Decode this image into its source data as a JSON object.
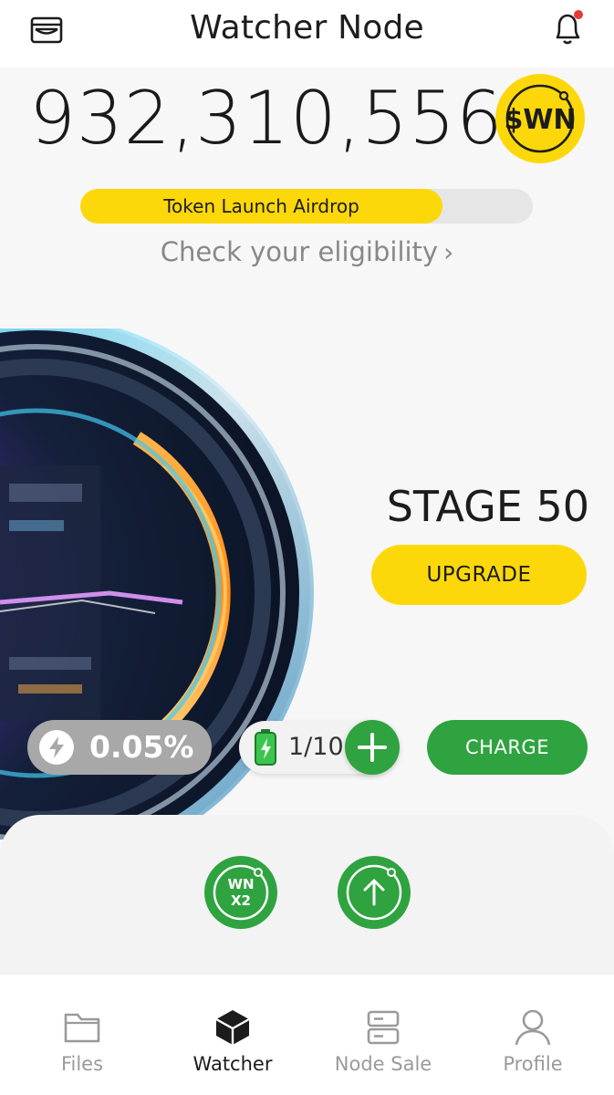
{
  "header": {
    "title": "Watcher Node",
    "wallet_icon": "wallet-icon",
    "bell_icon": "bell-icon",
    "notification_dot_color": "#e53935"
  },
  "balance": {
    "amount": "932,310,556",
    "token_symbol": "$WN"
  },
  "airdrop": {
    "label": "Token Launch Airdrop",
    "progress_fraction": 0.8,
    "eligibility_text": "Check your eligibility"
  },
  "stage": {
    "label": "STAGE 50",
    "upgrade_label": "UPGRADE"
  },
  "controls": {
    "rate": "0.05%",
    "battery": "1/10",
    "charge_label": "CHARGE",
    "add_icon": "plus-icon",
    "bolt_icon": "bolt-icon",
    "battery_icon": "battery-icon"
  },
  "actions": {
    "boost_line1": "WN",
    "boost_line2": "X2",
    "send_icon": "arrow-up-icon"
  },
  "tabs": [
    {
      "label": "Files",
      "icon": "folder-icon",
      "active": false
    },
    {
      "label": "Watcher",
      "icon": "cube-icon",
      "active": true
    },
    {
      "label": "Node Sale",
      "icon": "server-icon",
      "active": false
    },
    {
      "label": "Profile",
      "icon": "user-icon",
      "active": false
    }
  ],
  "colors": {
    "accent_yellow": "#fcd80a",
    "accent_green": "#2fa33f",
    "muted_gray": "#888888"
  }
}
